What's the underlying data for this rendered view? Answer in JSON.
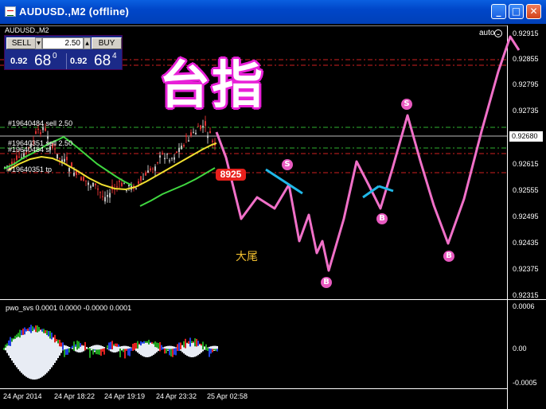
{
  "window": {
    "title": "AUDUSD.,M2 (offline)",
    "minimize_glyph": "_",
    "maximize_glyph": "□",
    "close_glyph": "✕"
  },
  "chart": {
    "symbol_label": "AUDUSD.,M2",
    "auto_label": "auto",
    "trade_panel": {
      "sell_label": "SELL",
      "buy_label": "BUY",
      "lot": "2.50",
      "sell_price_small": "0.92",
      "sell_price_large": "68",
      "sell_price_sup": "0",
      "buy_price_small": "0.92",
      "buy_price_large": "68",
      "buy_price_sup": "4"
    },
    "overlay_title": "台指",
    "marker_value": "8925",
    "annotation_text": "大尾",
    "current_price": "0.92680",
    "orders": [
      "#19640484 sell 2.50",
      "#19640351 sell 2.50",
      "#19640484 sl",
      "#19640351 tp"
    ],
    "price_scale": [
      "0.92915",
      "0.92855",
      "0.92795",
      "0.92735",
      "0.92680",
      "0.92615",
      "0.92555",
      "0.92495",
      "0.92435",
      "0.92375",
      "0.92315"
    ],
    "time_labels": [
      "24 Apr 2014",
      "24 Apr 18:22",
      "24 Apr 19:19",
      "24 Apr 23:32",
      "25 Apr 02:58"
    ],
    "swing_labels": [
      "S",
      "S",
      "S",
      "B",
      "B",
      "B"
    ],
    "oscillator": {
      "label": "pwo_svs 0.0001 0.0000 -0.0000 0.0001",
      "scale": [
        "0.0006",
        "0.00",
        "-0.0005"
      ]
    },
    "colors": {
      "background": "#000000",
      "candle_up": "#c0c0c0",
      "candle_down": "#d83030",
      "band_green": "#40d840",
      "ma_yellow": "#f0e030",
      "drawing_pink": "#f070c8",
      "drawing_cyan": "#20b8e8",
      "order_green": "#30b030",
      "order_red": "#d02020"
    }
  }
}
